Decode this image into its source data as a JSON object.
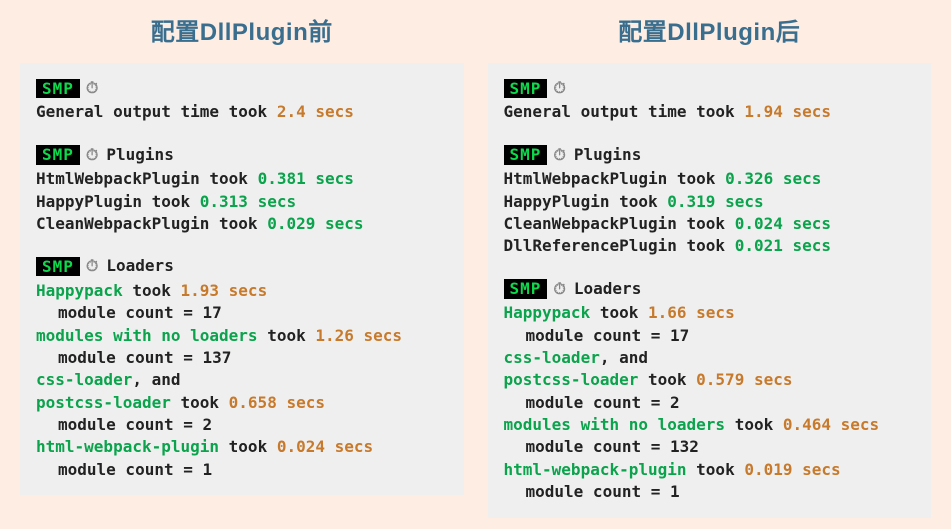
{
  "left": {
    "title": "配置DllPlugin前",
    "general_prefix": "General output time took ",
    "general_time": "2.4 secs",
    "labels": {
      "plugins": "Plugins",
      "loaders": "Loaders",
      "smp": "SMP"
    },
    "plugins": [
      {
        "name": "HtmlWebpackPlugin",
        "took": " took ",
        "time": "0.381 secs"
      },
      {
        "name": "HappyPlugin",
        "took": " took ",
        "time": "0.313 secs"
      },
      {
        "name": "CleanWebpackPlugin",
        "took": " took ",
        "time": "0.029 secs"
      }
    ],
    "loaders": [
      {
        "entries": [
          {
            "name": "Happypack"
          }
        ],
        "took": " took ",
        "time": "1.93 secs",
        "module_label": "module count = ",
        "module_count": "17"
      },
      {
        "entries": [
          {
            "name": "modules with no loaders"
          }
        ],
        "took": " took ",
        "time": "1.26 secs",
        "module_label": "module count = ",
        "module_count": "137"
      },
      {
        "entries": [
          {
            "name": "css-loader",
            "suffix": ", and"
          },
          {
            "name": "postcss-loader"
          }
        ],
        "took": " took ",
        "time": "0.658 secs",
        "module_label": "module count = ",
        "module_count": "2"
      },
      {
        "entries": [
          {
            "name": "html-webpack-plugin"
          }
        ],
        "took": " took ",
        "time": "0.024 secs",
        "module_label": "module count = ",
        "module_count": "1"
      }
    ]
  },
  "right": {
    "title": "配置DllPlugin后",
    "general_prefix": "General output time took ",
    "general_time": "1.94 secs",
    "labels": {
      "plugins": "Plugins",
      "loaders": "Loaders",
      "smp": "SMP"
    },
    "plugins": [
      {
        "name": "HtmlWebpackPlugin",
        "took": " took ",
        "time": "0.326 secs"
      },
      {
        "name": "HappyPlugin",
        "took": " took ",
        "time": "0.319 secs"
      },
      {
        "name": "CleanWebpackPlugin",
        "took": " took ",
        "time": "0.024 secs"
      },
      {
        "name": "DllReferencePlugin",
        "took": " took ",
        "time": "0.021 secs"
      }
    ],
    "loaders": [
      {
        "entries": [
          {
            "name": "Happypack"
          }
        ],
        "took": " took ",
        "time": "1.66 secs",
        "module_label": "module count = ",
        "module_count": "17"
      },
      {
        "entries": [
          {
            "name": "css-loader",
            "suffix": ", and"
          },
          {
            "name": "postcss-loader"
          }
        ],
        "took": " took ",
        "time": "0.579 secs",
        "module_label": "module count = ",
        "module_count": "2"
      },
      {
        "entries": [
          {
            "name": "modules with no loaders"
          }
        ],
        "took": " took ",
        "time": "0.464 secs",
        "module_label": "module count = ",
        "module_count": "132"
      },
      {
        "entries": [
          {
            "name": "html-webpack-plugin"
          }
        ],
        "took": " took ",
        "time": "0.019 secs",
        "module_label": "module count = ",
        "module_count": "1"
      }
    ]
  }
}
